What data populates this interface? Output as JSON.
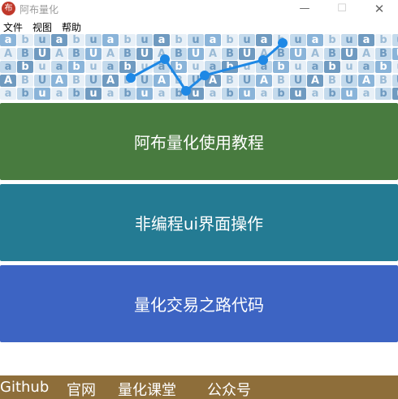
{
  "window": {
    "title": "阿布量化",
    "icon_glyph": "布",
    "minimize_glyph": "—",
    "maximize_glyph": "☐",
    "close_glyph": "✕"
  },
  "menu": {
    "items": [
      "文件",
      "视图",
      "帮助"
    ]
  },
  "banner": {
    "icon": "abu-logo-pattern",
    "accent_color": "#1e88e5"
  },
  "buttons": {
    "tutorial": "阿布量化使用教程",
    "ui_operation": "非编程ui界面操作",
    "code_path": "量化交易之路代码"
  },
  "footer": {
    "links": [
      "Github",
      "官网",
      "量化课堂",
      "公众号"
    ]
  },
  "colors": {
    "tutorial_bg": "#487b3f",
    "ui_bg": "#247b93",
    "code_bg": "#3d64c3",
    "footer_bg": "#8e6e3a"
  }
}
